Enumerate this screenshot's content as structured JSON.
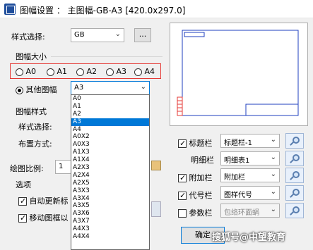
{
  "window": {
    "title": "图幅设置 ： 主图幅-GB-A3 [420.0x297.0]"
  },
  "style": {
    "label": "样式选择:",
    "value": "GB",
    "more_button": "..."
  },
  "size_group": {
    "title": "图幅大小",
    "options": [
      "A0",
      "A1",
      "A2",
      "A3",
      "A4"
    ],
    "other_label": "其他图幅",
    "other_value": "A3"
  },
  "dropdown": {
    "items": [
      "A0",
      "A1",
      "A2",
      "A3",
      "A4",
      "A0X2",
      "A0X3",
      "A1X3",
      "A1X4",
      "A2X3",
      "A2X4",
      "A2X5",
      "A3X3",
      "A3X4",
      "A3X5",
      "A3X6",
      "A3X7",
      "A4X3",
      "A4X4"
    ],
    "selected": "A3"
  },
  "frame_style": {
    "title": "图幅样式",
    "style_label": "样式选择:",
    "layout_label": "布置方式:"
  },
  "scale": {
    "label": "绘图比例:",
    "value": "1"
  },
  "options": {
    "title": "选项",
    "auto_update": "自动更新标",
    "move_frame": "移动图框以"
  },
  "right": {
    "title_block": {
      "label": "标题栏",
      "value": "标题栏-1"
    },
    "detail": {
      "label": "明细栏",
      "value": "明细表1"
    },
    "extra": {
      "label": "附加栏",
      "value": "附加栏"
    },
    "code": {
      "label": "代号栏",
      "value": "图样代号"
    },
    "param": {
      "label": "参数栏",
      "value": "包络环面蜗"
    }
  },
  "ok_button": "确定",
  "watermark": "搜狐号@中望教育",
  "colors": {
    "selection": "#0078d7",
    "highlight_box": "#e53935",
    "preview_frame": "#1f3fbf"
  }
}
